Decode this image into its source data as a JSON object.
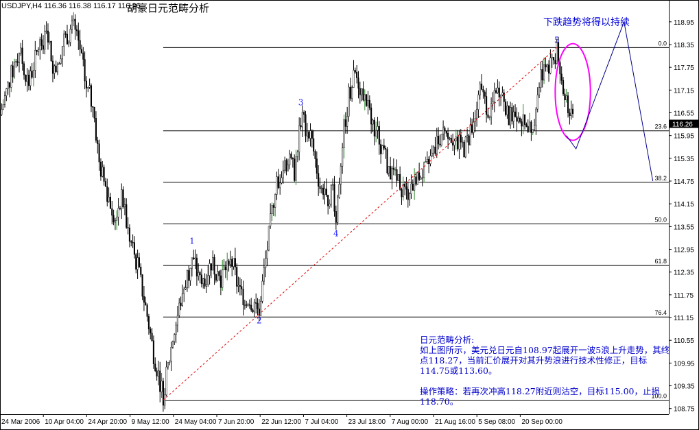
{
  "header": {
    "symbol": "USDJPY,H4",
    "ohlc": "116.36 116.38 116.17 116.26",
    "title": "胡豪日元范畴分析"
  },
  "annotations": {
    "forecast": "下跌趋势将得以持续",
    "note_title": "日元范畴分析:",
    "note_line1": "如上图所示，美元兑日元自108.97起展开一波5浪上升走势，其终点118.27，当前汇价展开对其升势浪进行技术性修正，目标114.75或113.60。",
    "note_line2": "操作策略：若再次冲高118.27附近则沽空，目标115.00，止损118.70。"
  },
  "colors": {
    "candle": "#000000",
    "bull_accent": "#2a8a2a",
    "wave_label": "#1a1aff",
    "forecast_line": "#00008b",
    "ellipse": "#ff00ff",
    "trendline": "#e00000",
    "price_tag_bg": "#000000"
  },
  "chart_data": {
    "type": "candlestick",
    "symbol": "USDJPY",
    "timeframe": "H4",
    "y_range": [
      108.6,
      119.2
    ],
    "y_ticks": [
      118.95,
      118.35,
      117.75,
      117.15,
      116.55,
      115.95,
      115.35,
      114.75,
      114.15,
      113.55,
      112.95,
      112.35,
      111.75,
      111.15,
      110.55,
      109.95,
      109.35,
      108.75
    ],
    "x_labels": [
      "24 Mar 2006",
      "10 Apr 04:00",
      "24 Apr 20:00",
      "9 May 12:00",
      "24 May 04:00",
      "7 Jun 20:00",
      "22 Jun 12:00",
      "7 Jul 04:00",
      "23 Jul 18:00",
      "7 Aug 00:00",
      "21 Aug 16:00",
      "5 Sep 08:00",
      "20 Sep 00:00"
    ],
    "current_price": 116.26,
    "fibonacci": {
      "high": 118.27,
      "low": 108.97,
      "levels": [
        {
          "label": "0.0",
          "ratio": 0.0
        },
        {
          "label": "23.6",
          "ratio": 0.236
        },
        {
          "label": "38.2",
          "ratio": 0.382
        },
        {
          "label": "50.0",
          "ratio": 0.5
        },
        {
          "label": "61.8",
          "ratio": 0.618
        },
        {
          "label": "76.4",
          "ratio": 0.764
        },
        {
          "label": "100.0",
          "ratio": 1.0
        }
      ]
    },
    "wave_labels": [
      {
        "label": "1",
        "date": "2006-05-23",
        "price": 112.95
      },
      {
        "label": "2",
        "date": "2006-06-13",
        "price": 111.25
      },
      {
        "label": "3",
        "date": "2006-06-26",
        "price": 116.6
      },
      {
        "label": "4",
        "date": "2006-07-07",
        "price": 113.55
      },
      {
        "label": "5",
        "date": "2006-09-14",
        "price": 118.25
      }
    ],
    "trendline": {
      "from": {
        "date": "2006-05-14",
        "price": 108.97
      },
      "to": {
        "date": "2006-09-14",
        "price": 118.27
      }
    },
    "ellipse": {
      "center": {
        "date": "2006-09-19",
        "price": 117.1
      },
      "date_span_days": 11,
      "price_span": 2.55
    },
    "forecast_path": [
      {
        "date": "2006-09-20",
        "price": 115.6
      },
      {
        "date": "2006-10-05",
        "price": 118.95
      },
      {
        "date": "2006-10-14",
        "price": 114.75
      }
    ],
    "candle_path": [
      {
        "date": "2006-03-24",
        "price": 116.5
      },
      {
        "date": "2006-03-27",
        "price": 117.4
      },
      {
        "date": "2006-03-30",
        "price": 118.2
      },
      {
        "date": "2006-04-02",
        "price": 117.3
      },
      {
        "date": "2006-04-05",
        "price": 118.3
      },
      {
        "date": "2006-04-08",
        "price": 118.6
      },
      {
        "date": "2006-04-10",
        "price": 117.6
      },
      {
        "date": "2006-04-13",
        "price": 118.5
      },
      {
        "date": "2006-04-16",
        "price": 118.8
      },
      {
        "date": "2006-04-18",
        "price": 118.2
      },
      {
        "date": "2006-04-20",
        "price": 117.2
      },
      {
        "date": "2006-04-22",
        "price": 116.8
      },
      {
        "date": "2006-04-24",
        "price": 115.2
      },
      {
        "date": "2006-04-27",
        "price": 114.3
      },
      {
        "date": "2006-04-29",
        "price": 113.8
      },
      {
        "date": "2006-05-01",
        "price": 114.4
      },
      {
        "date": "2006-05-03",
        "price": 113.4
      },
      {
        "date": "2006-05-06",
        "price": 112.5
      },
      {
        "date": "2006-05-09",
        "price": 111.2
      },
      {
        "date": "2006-05-11",
        "price": 110.2
      },
      {
        "date": "2006-05-14",
        "price": 109.1
      },
      {
        "date": "2006-05-17",
        "price": 110.6
      },
      {
        "date": "2006-05-20",
        "price": 111.8
      },
      {
        "date": "2006-05-23",
        "price": 112.7
      },
      {
        "date": "2006-05-26",
        "price": 112.0
      },
      {
        "date": "2006-05-29",
        "price": 112.6
      },
      {
        "date": "2006-06-01",
        "price": 112.2
      },
      {
        "date": "2006-06-04",
        "price": 112.8
      },
      {
        "date": "2006-06-07",
        "price": 111.8
      },
      {
        "date": "2006-06-10",
        "price": 111.6
      },
      {
        "date": "2006-06-13",
        "price": 111.4
      },
      {
        "date": "2006-06-16",
        "price": 113.3
      },
      {
        "date": "2006-06-18",
        "price": 114.6
      },
      {
        "date": "2006-06-20",
        "price": 115.0
      },
      {
        "date": "2006-06-22",
        "price": 115.3
      },
      {
        "date": "2006-06-24",
        "price": 115.0
      },
      {
        "date": "2006-06-26",
        "price": 116.4
      },
      {
        "date": "2006-06-29",
        "price": 116.0
      },
      {
        "date": "2006-07-02",
        "price": 114.6
      },
      {
        "date": "2006-07-04",
        "price": 114.2
      },
      {
        "date": "2006-07-06",
        "price": 114.6
      },
      {
        "date": "2006-07-07",
        "price": 113.8
      },
      {
        "date": "2006-07-09",
        "price": 115.8
      },
      {
        "date": "2006-07-11",
        "price": 117.0
      },
      {
        "date": "2006-07-13",
        "price": 117.6
      },
      {
        "date": "2006-07-16",
        "price": 116.9
      },
      {
        "date": "2006-07-18",
        "price": 116.4
      },
      {
        "date": "2006-07-20",
        "price": 116.0
      },
      {
        "date": "2006-07-23",
        "price": 115.2
      },
      {
        "date": "2006-07-26",
        "price": 114.8
      },
      {
        "date": "2006-07-29",
        "price": 114.4
      },
      {
        "date": "2006-08-01",
        "price": 114.9
      },
      {
        "date": "2006-08-04",
        "price": 115.0
      },
      {
        "date": "2006-08-07",
        "price": 115.6
      },
      {
        "date": "2006-08-10",
        "price": 116.2
      },
      {
        "date": "2006-08-13",
        "price": 115.8
      },
      {
        "date": "2006-08-16",
        "price": 115.6
      },
      {
        "date": "2006-08-19",
        "price": 116.2
      },
      {
        "date": "2006-08-21",
        "price": 117.1
      },
      {
        "date": "2006-08-24",
        "price": 116.6
      },
      {
        "date": "2006-08-27",
        "price": 117.2
      },
      {
        "date": "2006-08-30",
        "price": 116.4
      },
      {
        "date": "2006-09-02",
        "price": 116.6
      },
      {
        "date": "2006-09-05",
        "price": 115.9
      },
      {
        "date": "2006-09-07",
        "price": 116.5
      },
      {
        "date": "2006-09-09",
        "price": 117.6
      },
      {
        "date": "2006-09-11",
        "price": 117.9
      },
      {
        "date": "2006-09-13",
        "price": 117.7
      },
      {
        "date": "2006-09-14",
        "price": 118.2
      },
      {
        "date": "2006-09-16",
        "price": 117.2
      },
      {
        "date": "2006-09-17",
        "price": 117.0
      },
      {
        "date": "2006-09-18",
        "price": 116.5
      },
      {
        "date": "2006-09-19",
        "price": 116.26
      }
    ]
  }
}
